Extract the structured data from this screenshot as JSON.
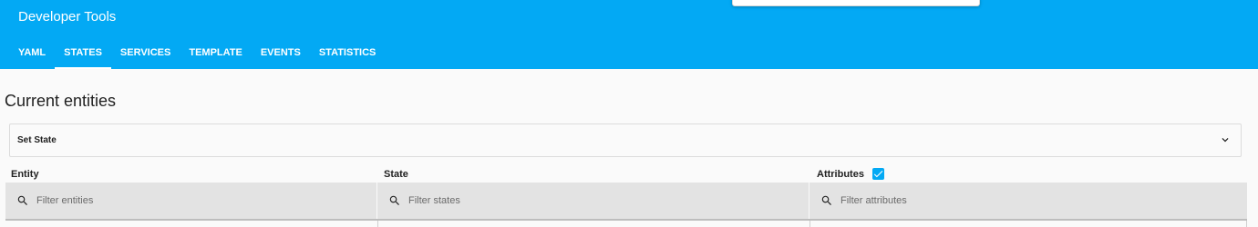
{
  "app": {
    "title": "Developer Tools"
  },
  "tabs": [
    {
      "label": "YAML",
      "active": false
    },
    {
      "label": "STATES",
      "active": true
    },
    {
      "label": "SERVICES",
      "active": false
    },
    {
      "label": "TEMPLATE",
      "active": false
    },
    {
      "label": "EVENTS",
      "active": false
    },
    {
      "label": "STATISTICS",
      "active": false
    }
  ],
  "main": {
    "title": "Current entities",
    "set_state": {
      "label": "Set State",
      "icon": "chevron-down-icon"
    }
  },
  "table": {
    "columns": {
      "entity": "Entity",
      "state": "State",
      "attributes": "Attributes"
    },
    "attributes_checkbox": {
      "checked": true
    },
    "filters": {
      "entity_placeholder": "Filter entities",
      "state_placeholder": "Filter states",
      "attributes_placeholder": "Filter attributes"
    }
  },
  "colors": {
    "accent": "#03a9f4",
    "filter_bg": "#e3e3e3",
    "page_bg": "#fafafa"
  }
}
